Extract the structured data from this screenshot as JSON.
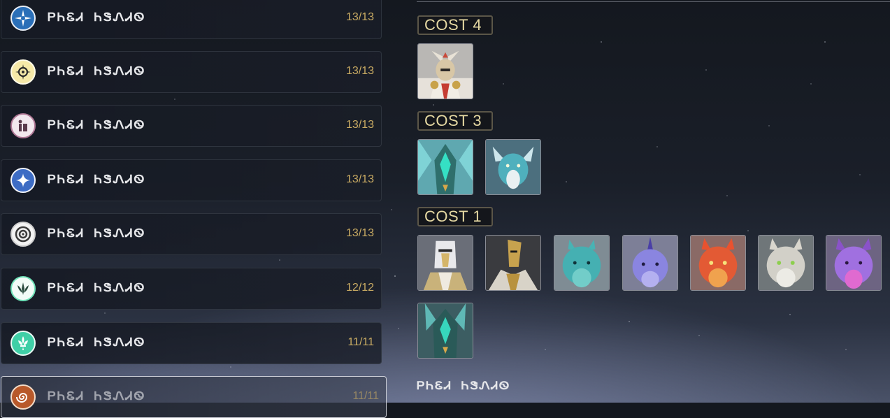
{
  "element_list": [
    {
      "icon": "anemo-star-icon",
      "name": "ᏢᏂᏋᏗ ᏂᏕᏁᏗᏫ",
      "count": "13/13",
      "color": "#3d8fd6"
    },
    {
      "icon": "geo-compass-icon",
      "name": "ᏢᏂᏋᏗ ᏂᏕᏁᏗᏫ",
      "count": "13/13",
      "color": "#f0d75a"
    },
    {
      "icon": "knight-helmet-icon",
      "name": "ᏢᏂᏋᏗ ᏂᏕᏁᏗᏫ",
      "count": "13/13",
      "color": "#c98aa8"
    },
    {
      "icon": "sparkle-star-icon",
      "name": "ᏢᏂᏋᏗ ᏂᏕᏁᏗᏫ",
      "count": "13/13",
      "color": "#6ea0e6"
    },
    {
      "icon": "target-ring-icon",
      "name": "ᏢᏂᏋᏗ ᏂᏕᏁᏗᏫ",
      "count": "13/13",
      "color": "#d8d8d8"
    },
    {
      "icon": "leaf-crest-icon",
      "name": "ᏢᏂᏋᏗ ᏂᏕᏁᏗᏫ",
      "count": "12/12",
      "color": "#5fe0b0"
    },
    {
      "icon": "fleur-de-lis-icon",
      "name": "ᏢᏂᏋᏗ ᏂᏕᏁᏗᏫ",
      "count": "11/11",
      "color": "#5fd7b8"
    },
    {
      "icon": "spiral-swirl-icon",
      "name": "ᏢᏂᏋᏗ ᏂᏕᏁᏗᏫ",
      "count": "11/11",
      "color": "#d07a3a"
    }
  ],
  "list_labels": {
    "row0": "ᏢᏂᏋᏗ ᏂᏕᏁᏗᏫ",
    "row1": "ᏢᏂᏋᏗ ᏂᏕᏁᏗᏫ",
    "row2": "ᏢᏂᏋᏗ ᏂᏕᏁᏗᏫ",
    "row3": "ᏢᏂᏋᏗ ᏂᏕᏁᏗᏫ",
    "row4": "ᏢᏂᏋᏗ ᏂᏕᏁᏗᏫ",
    "row5": "ᏢᏂᏋᏗ ᏂᏕᏁᏗᏫ",
    "row6": "ᏢᏂᏋᏗ ᏂᏕᏁᏗᏫ",
    "row7": "ᏢᏂᏋᏗ ᏂᏕᏁᏗᏫ",
    "count0": "13/13",
    "count1": "13/13",
    "count2": "13/13",
    "count3": "13/13",
    "count4": "13/13",
    "count5": "12/12",
    "count6": "11/11",
    "count7": "11/11"
  },
  "cost_groups": {
    "cost4_label": "COST  4",
    "cost3_label": "COST  3",
    "cost1_label": "COST  1"
  },
  "portraits": [
    {
      "name": "winged-knight-portrait",
      "cost": 4
    },
    {
      "name": "teal-crystal-dragon-portrait",
      "cost": 3
    },
    {
      "name": "ice-dragon-portrait",
      "cost": 3
    },
    {
      "name": "golden-knight-portrait",
      "cost": 1
    },
    {
      "name": "dark-bladed-knight-portrait",
      "cost": 1
    },
    {
      "name": "teal-dragon-whelp-portrait",
      "cost": 1
    },
    {
      "name": "violet-dragon-whelp-portrait",
      "cost": 1
    },
    {
      "name": "red-dragon-whelp-portrait",
      "cost": 1
    },
    {
      "name": "white-dragon-whelp-portrait",
      "cost": 1
    },
    {
      "name": "purple-dragon-whelp-portrait",
      "cost": 1
    },
    {
      "name": "teal-crystal-dragon-portrait-2",
      "cost": 1
    }
  ],
  "footer_label": "ᏢᏂᏋᏗ ᏂᏕᏁᏗᏫ"
}
